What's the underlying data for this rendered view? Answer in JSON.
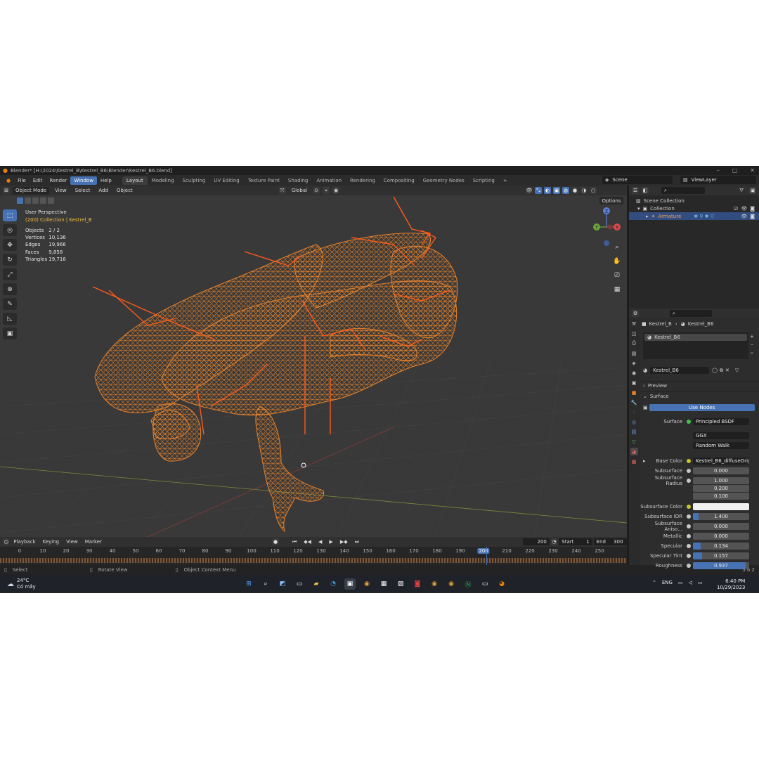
{
  "window": {
    "title": "Blender* [H:\\2024\\Kestrel_B\\Kestrel_B6\\Blender\\Kestrel_B6.blend]"
  },
  "menu": [
    "File",
    "Edit",
    "Render",
    "Window",
    "Help"
  ],
  "workspaces": [
    "Layout",
    "Modeling",
    "Sculpting",
    "UV Editing",
    "Texture Paint",
    "Shading",
    "Animation",
    "Rendering",
    "Compositing",
    "Geometry Nodes",
    "Scripting"
  ],
  "scene": "Scene",
  "view_layer": "ViewLayer",
  "viewport_header": {
    "mode": "Object Mode",
    "view": "View",
    "select": "Select",
    "add": "Add",
    "object": "Object",
    "orientation": "Global"
  },
  "viewport": {
    "perspective": "User Perspective",
    "collection": "(200) Collection | Kestrel_B",
    "options": "Options",
    "stats": [
      {
        "label": "Objects",
        "value": "2 / 2"
      },
      {
        "label": "Vertices",
        "value": "10,136"
      },
      {
        "label": "Edges",
        "value": "19,966"
      },
      {
        "label": "Faces",
        "value": "9,858"
      },
      {
        "label": "Triangles",
        "value": "19,716"
      }
    ],
    "gizmo": {
      "z": "Z",
      "y": "Y",
      "x": "X"
    }
  },
  "timeline": {
    "playback": "Playback",
    "keying": "Keying",
    "view": "View",
    "marker": "Marker",
    "current_frame": "200",
    "start_label": "Start",
    "start": "1",
    "end_label": "End",
    "end": "300",
    "ticks": [
      "0",
      "10",
      "20",
      "30",
      "40",
      "50",
      "60",
      "70",
      "80",
      "90",
      "100",
      "110",
      "120",
      "130",
      "140",
      "150",
      "160",
      "170",
      "180",
      "190",
      "200",
      "210",
      "220",
      "230",
      "240",
      "250"
    ]
  },
  "status": {
    "select": "Select",
    "rotate": "Rotate View",
    "context": "Object Context Menu",
    "version": "3.6.2"
  },
  "outliner": {
    "scene_collection": "Scene Collection",
    "collection": "Collection",
    "armature": "Armature"
  },
  "properties": {
    "breadcrumb_object": "Kestrel_B",
    "breadcrumb_material": "Kestrel_B6",
    "slot": "Kestrel_B6",
    "material_name": "Kestrel_B6",
    "preview": "Preview",
    "surface_panel": "Surface",
    "use_nodes": "Use Nodes",
    "surface_label": "Surface",
    "surface_value": "Principled BSDF",
    "distribution": "GGX",
    "subsurface_method": "Random Walk",
    "fields": [
      {
        "label": "Base Color",
        "value": "Kestrel_B6_diffuseOrig...",
        "kind": "texture",
        "fill": 0
      },
      {
        "label": "Subsurface",
        "value": "0.000",
        "kind": "number",
        "fill": 0
      },
      {
        "label": "Subsurface Radius",
        "value": "1.000",
        "kind": "number",
        "fill": 0
      },
      {
        "label": "",
        "value": "0.200",
        "kind": "number",
        "fill": 0
      },
      {
        "label": "",
        "value": "0.100",
        "kind": "number",
        "fill": 0
      },
      {
        "label": "Subsurface Color",
        "value": "",
        "kind": "color",
        "fill": 0
      },
      {
        "label": "Subsurface IOR",
        "value": "1.400",
        "kind": "number",
        "fill": 0.1
      },
      {
        "label": "Subsurface Aniso...",
        "value": "0.000",
        "kind": "number",
        "fill": 0
      },
      {
        "label": "Metallic",
        "value": "0.000",
        "kind": "number",
        "fill": 0
      },
      {
        "label": "Specular",
        "value": "0.134",
        "kind": "number",
        "fill": 0.134
      },
      {
        "label": "Specular Tint",
        "value": "0.157",
        "kind": "number",
        "fill": 0.157
      },
      {
        "label": "Roughness",
        "value": "0.937",
        "kind": "number",
        "fill": 0.937
      }
    ]
  },
  "taskbar": {
    "temperature": "24°C",
    "weather": "Có mây",
    "lang": "ENG",
    "time": "6:40 PM",
    "date": "10/29/2023"
  },
  "colors": {
    "accent": "#4772b3",
    "wire": "#e8822a",
    "bone": "#ff5a1a",
    "viewport_bg": "#393939"
  }
}
